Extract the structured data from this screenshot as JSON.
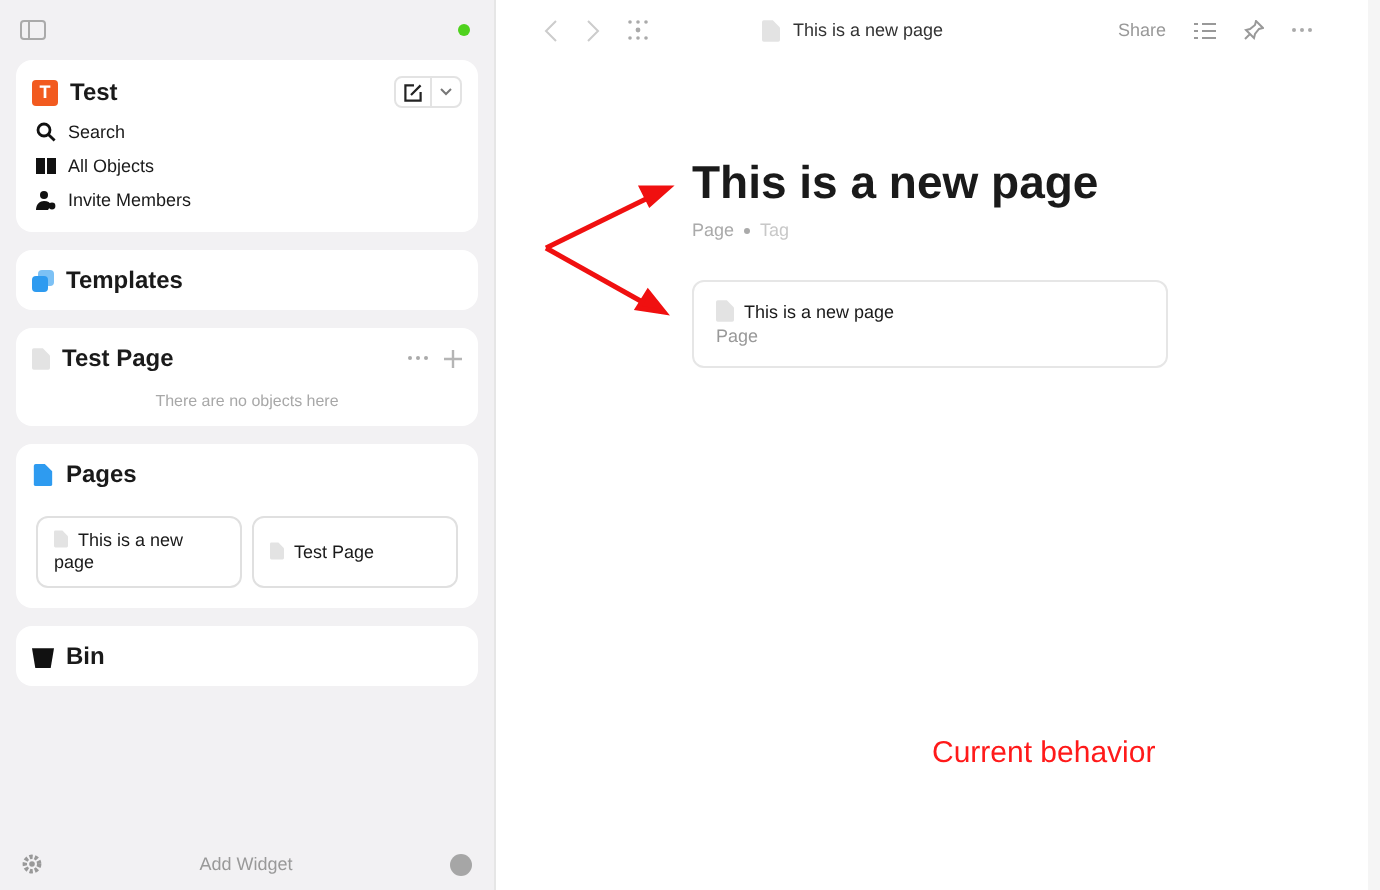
{
  "sidebar": {
    "space": {
      "initial": "T",
      "name": "Test"
    },
    "nav_items": [
      {
        "kind": "search",
        "label": "Search"
      },
      {
        "kind": "objects",
        "label": "All Objects"
      },
      {
        "kind": "members",
        "label": "Invite Members"
      }
    ],
    "widgets": [
      {
        "kind": "templates",
        "title": "Templates"
      },
      {
        "kind": "page",
        "title": "Test Page",
        "empty_text": "There are no objects here"
      },
      {
        "kind": "pages",
        "title": "Pages",
        "cards": [
          "This is a new page",
          "Test Page"
        ]
      },
      {
        "kind": "bin",
        "title": "Bin"
      }
    ],
    "footer": "Add Widget"
  },
  "toolbar": {
    "breadcrumb": "This is a new page",
    "share": "Share"
  },
  "page": {
    "title": "This is a new page",
    "type": "Page",
    "tag_placeholder": "Tag",
    "link_card": {
      "title": "This is a new page",
      "type": "Page"
    }
  },
  "annotation": "Current behavior"
}
